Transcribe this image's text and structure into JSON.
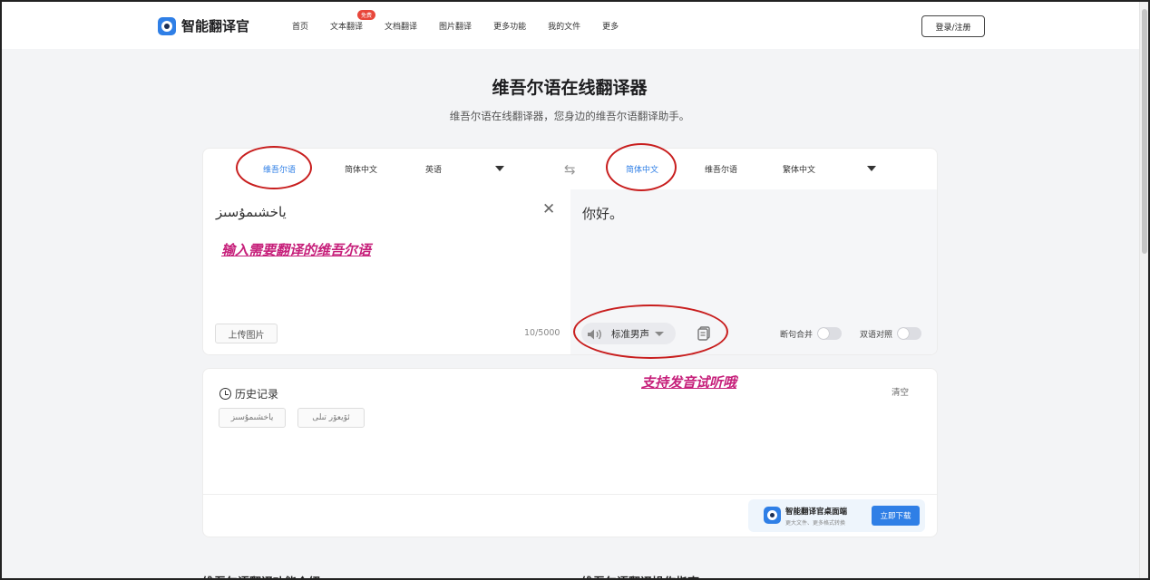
{
  "header": {
    "logo_text": "智能翻译官",
    "nav": [
      {
        "label": "首页"
      },
      {
        "label": "文本翻译",
        "badge": "免费"
      },
      {
        "label": "文档翻译"
      },
      {
        "label": "图片翻译"
      },
      {
        "label": "更多功能"
      },
      {
        "label": "我的文件"
      },
      {
        "label": "更多"
      }
    ],
    "login_label": "登录/注册"
  },
  "hero": {
    "title": "维吾尔语在线翻译器",
    "subtitle": "维吾尔语在线翻译器，您身边的维吾尔语翻译助手。"
  },
  "translator": {
    "source_langs": [
      "维吾尔语",
      "简体中文",
      "英语"
    ],
    "source_active": "维吾尔语",
    "target_langs": [
      "简体中文",
      "维吾尔语",
      "繁体中文"
    ],
    "target_active": "简体中文",
    "source_text": "ياخشىمۇسىز",
    "char_count": "10/5000",
    "upload_label": "上传图片",
    "output_text": "你好。",
    "voice_label": "标准男声",
    "toggle_merge_label": "断句合并",
    "toggle_bilingual_label": "双语对照"
  },
  "history": {
    "title": "历史记录",
    "clear_label": "清空",
    "items": [
      "ياخشىمۇسىز",
      "ئۆيعۆر تىلى"
    ]
  },
  "promo": {
    "title": "智能翻译官桌面端",
    "subtitle": "更大文件、更多格式转换",
    "button": "立即下载"
  },
  "annotations": {
    "input_hint": "输入需要翻译的维吾尔语",
    "voice_hint": "支持发音试听哦",
    "color": "#c61f7a",
    "circle_color": "#c81e1e"
  },
  "bottom": {
    "left_heading": "维吾尔语翻译功能介绍",
    "right_heading": "维吾尔语翻译操作指南"
  },
  "colors": {
    "accent": "#2f7fe6",
    "page_bg": "#f3f4f6"
  }
}
